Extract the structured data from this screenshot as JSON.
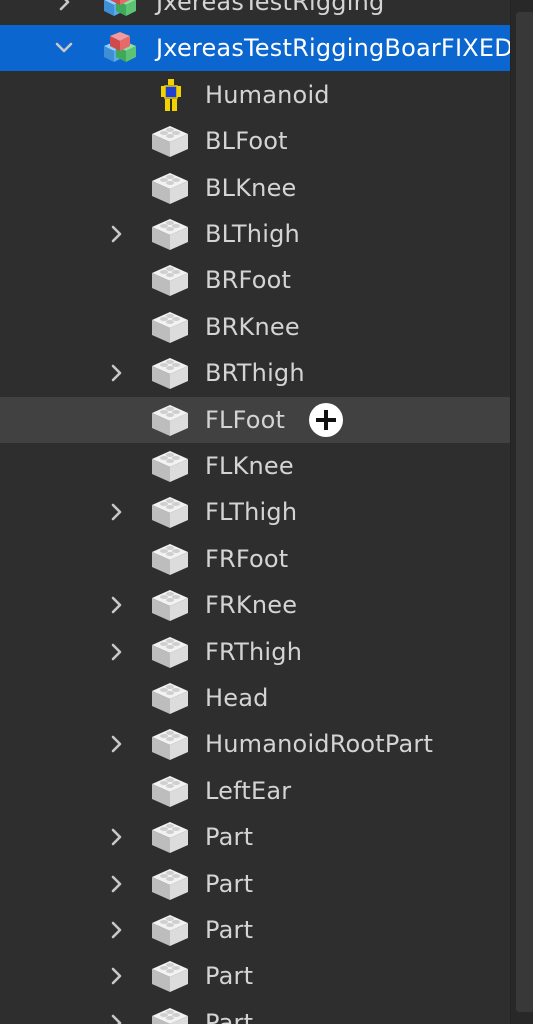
{
  "explorer": {
    "rows": [
      {
        "label": "JxereasTestRigging",
        "icon": "model-icon",
        "chevron": "right",
        "level": 1,
        "state": "normal"
      },
      {
        "label": "JxereasTestRiggingBoarFIXED",
        "icon": "model-icon",
        "chevron": "down",
        "level": 1,
        "state": "selected"
      },
      {
        "label": "Humanoid",
        "icon": "humanoid-icon",
        "chevron": "",
        "level": 2,
        "state": "normal"
      },
      {
        "label": "BLFoot",
        "icon": "part-icon",
        "chevron": "",
        "level": 2,
        "state": "normal"
      },
      {
        "label": "BLKnee",
        "icon": "part-icon",
        "chevron": "",
        "level": 2,
        "state": "normal"
      },
      {
        "label": "BLThigh",
        "icon": "part-icon",
        "chevron": "right",
        "level": 2,
        "state": "normal"
      },
      {
        "label": "BRFoot",
        "icon": "part-icon",
        "chevron": "",
        "level": 2,
        "state": "normal"
      },
      {
        "label": "BRKnee",
        "icon": "part-icon",
        "chevron": "",
        "level": 2,
        "state": "normal"
      },
      {
        "label": "BRThigh",
        "icon": "part-icon",
        "chevron": "right",
        "level": 2,
        "state": "normal"
      },
      {
        "label": "FLFoot",
        "icon": "part-icon",
        "chevron": "",
        "level": 2,
        "state": "hover",
        "insert_button": "plus-circle-icon"
      },
      {
        "label": "FLKnee",
        "icon": "part-icon",
        "chevron": "",
        "level": 2,
        "state": "normal"
      },
      {
        "label": "FLThigh",
        "icon": "part-icon",
        "chevron": "right",
        "level": 2,
        "state": "normal"
      },
      {
        "label": "FRFoot",
        "icon": "part-icon",
        "chevron": "",
        "level": 2,
        "state": "normal"
      },
      {
        "label": "FRKnee",
        "icon": "part-icon",
        "chevron": "right",
        "level": 2,
        "state": "normal"
      },
      {
        "label": "FRThigh",
        "icon": "part-icon",
        "chevron": "right",
        "level": 2,
        "state": "normal"
      },
      {
        "label": "Head",
        "icon": "part-icon",
        "chevron": "",
        "level": 2,
        "state": "normal"
      },
      {
        "label": "HumanoidRootPart",
        "icon": "part-icon",
        "chevron": "right",
        "level": 2,
        "state": "normal"
      },
      {
        "label": "LeftEar",
        "icon": "part-icon",
        "chevron": "",
        "level": 2,
        "state": "normal"
      },
      {
        "label": "Part",
        "icon": "part-icon",
        "chevron": "right",
        "level": 2,
        "state": "normal"
      },
      {
        "label": "Part",
        "icon": "part-icon",
        "chevron": "right",
        "level": 2,
        "state": "normal"
      },
      {
        "label": "Part",
        "icon": "part-icon",
        "chevron": "right",
        "level": 2,
        "state": "normal"
      },
      {
        "label": "Part",
        "icon": "part-icon",
        "chevron": "right",
        "level": 2,
        "state": "normal"
      },
      {
        "label": "Part",
        "icon": "part-icon",
        "chevron": "right",
        "level": 2,
        "state": "normal"
      }
    ]
  },
  "colors": {
    "background": "#2e2e2e",
    "selected_row": "#0b66cf",
    "hover_row": "#414141",
    "text": "#d4d4d4",
    "scrollbar_thumb": "#383838"
  }
}
